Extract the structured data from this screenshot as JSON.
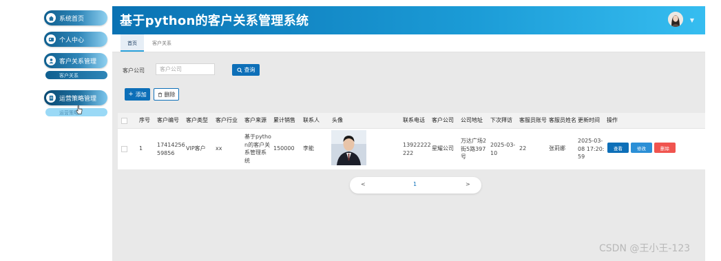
{
  "app": {
    "title": "基于python的客户关系管理系统"
  },
  "sidebar": {
    "items": [
      {
        "label": "系统首页",
        "icon": "home-icon"
      },
      {
        "label": "个人中心",
        "icon": "id-card-icon"
      },
      {
        "label": "客户关系管理",
        "icon": "user-icon"
      },
      {
        "label": "运营策略管理",
        "icon": "document-icon"
      }
    ],
    "submenus": [
      {
        "label": "客户关系"
      },
      {
        "label": "运营策略"
      }
    ]
  },
  "tabs": [
    {
      "label": "首页",
      "active": true
    },
    {
      "label": "客户关系",
      "active": false
    }
  ],
  "search": {
    "label": "客户公司",
    "placeholder": "客户公司",
    "button_label": "查询"
  },
  "toolbar": {
    "add_label": "添加",
    "delete_label": "删除"
  },
  "table": {
    "headers": [
      "序号",
      "客户编号",
      "客户类型",
      "客户行业",
      "客户来源",
      "累计销售",
      "联系人",
      "头像",
      "联系电话",
      "客户公司",
      "公司地址",
      "下次拜访",
      "客服员账号",
      "客服员姓名",
      "更新时间",
      "操作"
    ],
    "rows": [
      {
        "index": "1",
        "customer_no": [
          "17414256",
          "59856"
        ],
        "type": "VIP客户",
        "industry": "xx",
        "source": [
          "基于pytho",
          "n的客户关",
          "系管理系",
          "统"
        ],
        "sales": "150000",
        "contact": "李能",
        "phone": [
          "13922222",
          "222"
        ],
        "company": "星耀公司",
        "address": [
          "万达广场2",
          "街5路397",
          "号"
        ],
        "next_visit": [
          "2025-03-",
          "10"
        ],
        "agent_account": "22",
        "agent_name": "张莉娜",
        "updated": [
          "2025-03-",
          "08 17:20:",
          "59"
        ],
        "actions": {
          "view": "查看",
          "edit": "修改",
          "delete": "删除"
        }
      }
    ]
  },
  "pagination": {
    "prev": "<",
    "current": "1",
    "next": ">"
  },
  "watermark": "CSDN @王小王-123",
  "colors": {
    "primary": "#0d6fb8",
    "header_start": "#0a72b3",
    "header_end": "#36bdf0",
    "view": "#0d6fb8",
    "edit": "#2b8fd6",
    "delete": "#f0544f"
  }
}
